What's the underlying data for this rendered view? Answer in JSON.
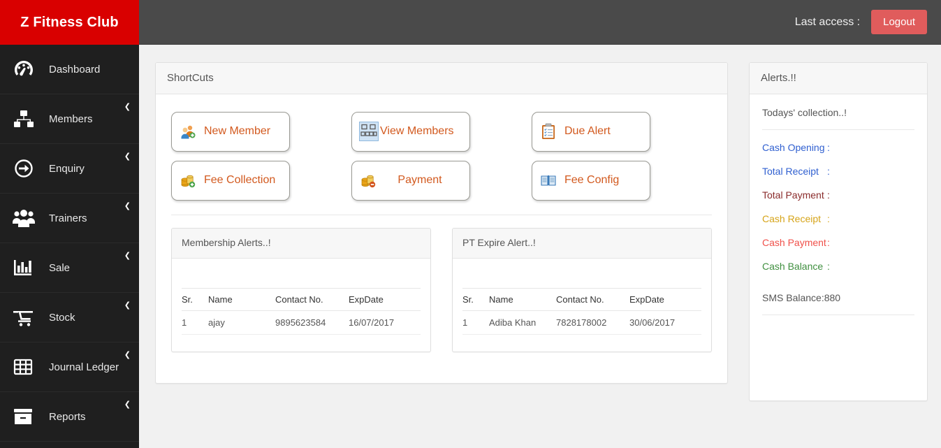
{
  "brand": {
    "title": "Z Fitness Club",
    "bg_color": "#d90000"
  },
  "topbar": {
    "last_access_label": "Last access :",
    "logout_label": "Logout",
    "logout_color": "#e05c5c",
    "bg_color": "#4a4a4a"
  },
  "sidebar": {
    "bg_color": "#1f1f1f",
    "items": [
      {
        "label": "Dashboard",
        "icon": "dashboard-gauge-icon",
        "has_chevron": false
      },
      {
        "label": "Members",
        "icon": "org-chart-icon",
        "has_chevron": true
      },
      {
        "label": "Enquiry",
        "icon": "arrow-circle-icon",
        "has_chevron": true
      },
      {
        "label": "Trainers",
        "icon": "people-group-icon",
        "has_chevron": true
      },
      {
        "label": "Sale",
        "icon": "bar-chart-icon",
        "has_chevron": true
      },
      {
        "label": "Stock",
        "icon": "shopping-cart-icon",
        "has_chevron": true
      },
      {
        "label": "Journal Ledger",
        "icon": "grid-table-icon",
        "has_chevron": true
      },
      {
        "label": "Reports",
        "icon": "archive-box-icon",
        "has_chevron": true
      }
    ],
    "chevron_glyph": "❮"
  },
  "shortcuts": {
    "panel_title": "ShortCuts",
    "label_color": "#d2591e",
    "buttons": [
      {
        "label": "New Member",
        "icon": "new-member-icon"
      },
      {
        "label": "View Members",
        "icon": "view-members-icon"
      },
      {
        "label": "Due Alert",
        "icon": "clipboard-check-icon"
      },
      {
        "label": "Fee Collection",
        "icon": "coins-add-icon"
      },
      {
        "label": "Payment",
        "icon": "coins-remove-icon"
      },
      {
        "label": "Fee Config",
        "icon": "open-book-icon"
      }
    ]
  },
  "membership_alerts": {
    "title": "Membership Alerts..!",
    "columns": [
      "Sr.",
      "Name",
      "Contact No.",
      "ExpDate"
    ],
    "rows": [
      {
        "sr": "1",
        "name": "ajay",
        "contact": "9895623584",
        "expdate": "16/07/2017"
      }
    ]
  },
  "pt_expire_alerts": {
    "title": "PT Expire Alert..!",
    "columns": [
      "Sr.",
      "Name",
      "Contact No.",
      "ExpDate"
    ],
    "rows": [
      {
        "sr": "1",
        "name": "Adiba Khan",
        "contact": "7828178002",
        "expdate": "30/06/2017"
      }
    ]
  },
  "alerts": {
    "panel_title": "Alerts.!!",
    "subtitle": "Todays' collection..!",
    "lines": [
      {
        "label": "Cash Opening",
        "colon": ":",
        "color": "#2f5fd0"
      },
      {
        "label": "Total Receipt",
        "colon": ":",
        "color": "#2f5fd0"
      },
      {
        "label": "Total Payment",
        "colon": ":",
        "color": "#8a2b2b"
      },
      {
        "label": "Cash Receipt",
        "colon": ":",
        "color": "#d6a419"
      },
      {
        "label": "Cash Payment",
        "colon": ":",
        "color": "#f0504a"
      },
      {
        "label": "Cash Balance",
        "colon": ":",
        "color": "#3f8f3f"
      }
    ],
    "sms_balance": "SMS Balance:880"
  }
}
